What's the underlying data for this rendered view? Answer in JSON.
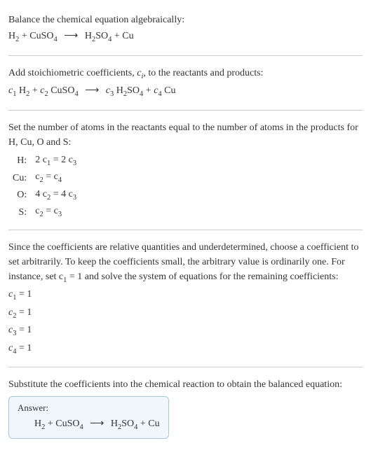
{
  "sections": {
    "intro": {
      "line1": "Balance the chemical equation algebraically:"
    },
    "step1": {
      "text": "Add stoichiometric coefficients, "
    },
    "step2": {
      "text": "Set the number of atoms in the reactants equal to the number of atoms in the products for H, Cu, O and S:",
      "rows": [
        {
          "el": "H:",
          "eq": "2 c",
          "s1": "1",
          "mid": " = 2 c",
          "s2": "3"
        },
        {
          "el": "Cu:",
          "eq": "c",
          "s1": "2",
          "mid": " = c",
          "s2": "4"
        },
        {
          "el": "O:",
          "eq": "4 c",
          "s1": "2",
          "mid": " = 4 c",
          "s2": "3"
        },
        {
          "el": "S:",
          "eq": "c",
          "s1": "2",
          "mid": " = c",
          "s2": "3"
        }
      ]
    },
    "step3": {
      "text1": "Since the coefficients are relative quantities and underdetermined, choose a coefficient to set arbitrarily. To keep the coefficients small, the arbitrary value is ordinarily one. For instance, set c",
      "text2": " = 1 and solve the system of equations for the remaining coefficients:",
      "rows": [
        {
          "c": "c",
          "s": "1",
          "v": " = 1"
        },
        {
          "c": "c",
          "s": "2",
          "v": " = 1"
        },
        {
          "c": "c",
          "s": "3",
          "v": " = 1"
        },
        {
          "c": "c",
          "s": "4",
          "v": " = 1"
        }
      ]
    },
    "step4": {
      "text": "Substitute the coefficients into the chemical reaction to obtain the balanced equation:"
    },
    "answer": {
      "label": "Answer:"
    }
  },
  "chem": {
    "H2": "H",
    "H2s": "2",
    "CuSO4_a": "CuSO",
    "CuSO4_s": "4",
    "H2SO4_a": "H",
    "H2SO4_s1": "2",
    "H2SO4_b": "SO",
    "H2SO4_s2": "4",
    "Cu": "Cu",
    "plus": " + ",
    "arrow": "⟶"
  },
  "coef": {
    "c": "c",
    "c1": "1",
    "c2": "2",
    "c3": "3",
    "c4": "4",
    "ci": "i",
    "suffix": ", to the reactants and products:"
  }
}
